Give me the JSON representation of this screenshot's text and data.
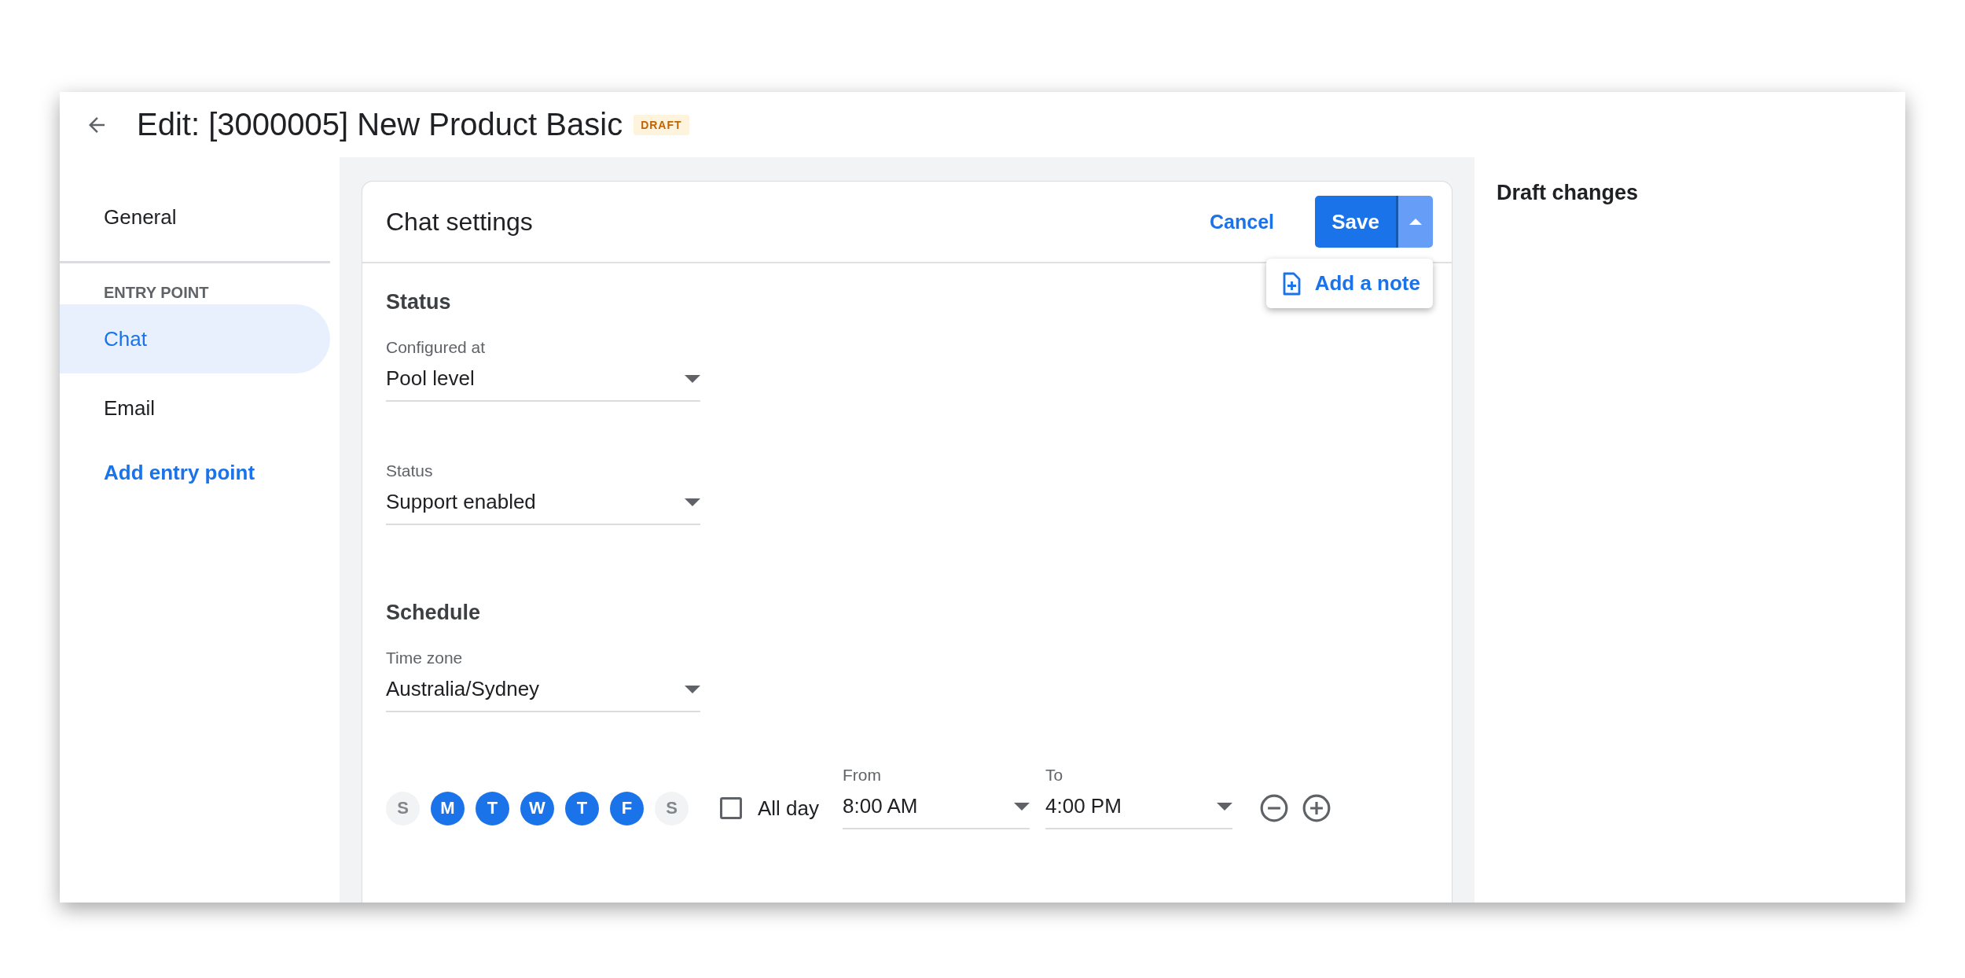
{
  "header": {
    "title": "Edit: [3000005] New Product Basic",
    "badge": "DRAFT"
  },
  "sidebar": {
    "items": [
      {
        "label": "General",
        "kind": "item",
        "selected": false
      },
      {
        "label": "ENTRY POINT",
        "kind": "section"
      },
      {
        "label": "Chat",
        "kind": "item",
        "selected": true
      },
      {
        "label": "Email",
        "kind": "item",
        "selected": false
      },
      {
        "label": "Add entry point",
        "kind": "link"
      }
    ]
  },
  "card": {
    "title": "Chat settings",
    "cancel": "Cancel",
    "save": "Save",
    "menu": {
      "open": true,
      "items": [
        "Add a note"
      ]
    },
    "sections": [
      {
        "heading": "Status",
        "fields": [
          {
            "label": "Configured at",
            "value": "Pool level"
          },
          {
            "label": "Status",
            "value": "Support enabled"
          }
        ]
      },
      {
        "heading": "Schedule",
        "fields": [
          {
            "label": "Time zone",
            "value": "Australia/Sydney"
          }
        ]
      }
    ],
    "schedule": {
      "days": [
        {
          "label": "S",
          "selected": false
        },
        {
          "label": "M",
          "selected": true
        },
        {
          "label": "T",
          "selected": true
        },
        {
          "label": "W",
          "selected": true
        },
        {
          "label": "T",
          "selected": true
        },
        {
          "label": "F",
          "selected": true
        },
        {
          "label": "S",
          "selected": false
        }
      ],
      "all_day": {
        "label": "All day",
        "checked": false
      },
      "from": {
        "label": "From",
        "value": "8:00 AM"
      },
      "to": {
        "label": "To",
        "value": "4:00 PM"
      }
    }
  },
  "draft_panel": {
    "title": "Draft changes"
  }
}
